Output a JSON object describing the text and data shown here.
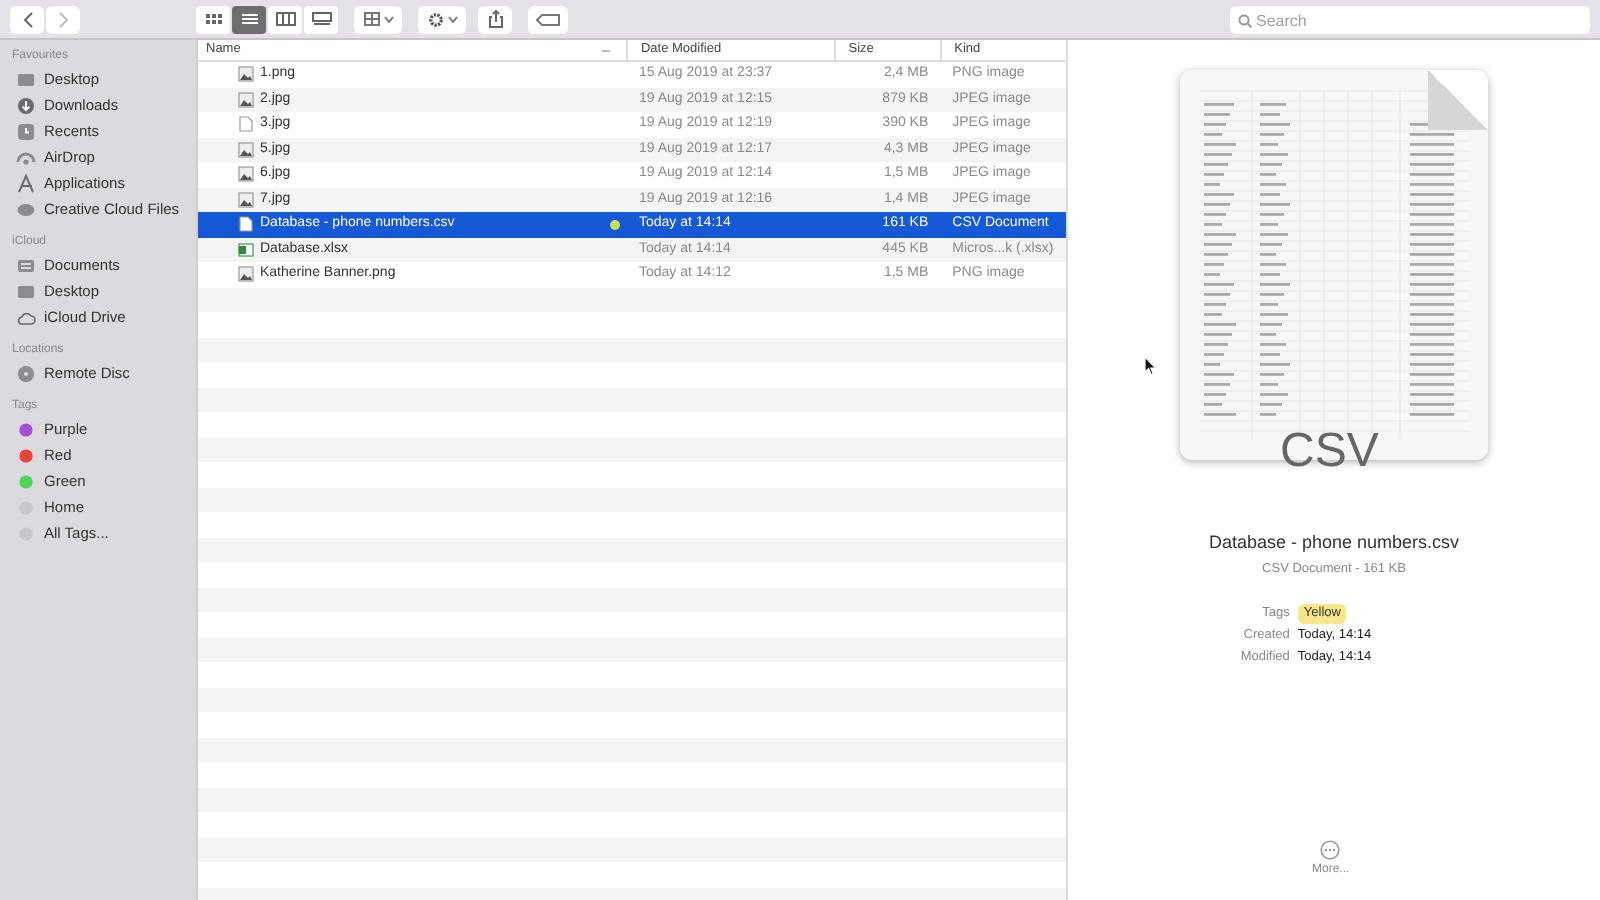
{
  "toolbar": {
    "views": [
      {
        "kind": "icons",
        "selected": false
      },
      {
        "kind": "list",
        "selected": true
      },
      {
        "kind": "columns",
        "selected": false
      },
      {
        "kind": "gallery",
        "selected": false
      }
    ],
    "search": {
      "placeholder": "Search"
    }
  },
  "sidebar": [
    {
      "title": "Favourites",
      "items": [
        {
          "label": "Desktop",
          "kind": "desktop"
        },
        {
          "label": "Downloads",
          "kind": "download"
        },
        {
          "label": "Recents",
          "kind": "clock"
        },
        {
          "label": "AirDrop",
          "kind": "airdrop"
        },
        {
          "label": "Applications",
          "kind": "apps"
        },
        {
          "label": "Creative Cloud Files",
          "kind": "cloudfolder"
        }
      ]
    },
    {
      "title": "iCloud",
      "items": [
        {
          "label": "Documents",
          "kind": "doc"
        },
        {
          "label": "Desktop",
          "kind": "desktop"
        },
        {
          "label": "iCloud Drive",
          "kind": "cloud"
        }
      ]
    },
    {
      "title": "Locations",
      "items": [
        {
          "label": "Remote Disc",
          "kind": "disc"
        }
      ]
    },
    {
      "title": "Tags",
      "items": [
        {
          "label": "Purple",
          "kind": "tag",
          "color": "#a64fd6"
        },
        {
          "label": "Red",
          "kind": "tag",
          "color": "#e8413b"
        },
        {
          "label": "Green",
          "kind": "tag",
          "color": "#4cd45a"
        },
        {
          "label": "Home",
          "kind": "tag",
          "color": "#c9c6cd"
        },
        {
          "label": "All Tags...",
          "kind": "alltags"
        }
      ]
    }
  ],
  "table": {
    "columns": [
      "Name",
      "Date Modified",
      "Size",
      "Kind"
    ],
    "rows": [
      {
        "name": "1.png",
        "date": "15 Aug 2019 at 23:37",
        "size": "2,4 MB",
        "type": "PNG image",
        "kind": "image",
        "selected": false
      },
      {
        "name": "2.jpg",
        "date": "19 Aug 2019 at 12:15",
        "size": "879 KB",
        "type": "JPEG image",
        "kind": "image",
        "selected": false
      },
      {
        "name": "3.jpg",
        "date": "19 Aug 2019 at 12:19",
        "size": "390 KB",
        "type": "JPEG image",
        "kind": "blank",
        "selected": false
      },
      {
        "name": "5.jpg",
        "date": "19 Aug 2019 at 12:17",
        "size": "4,3 MB",
        "type": "JPEG image",
        "kind": "image",
        "selected": false
      },
      {
        "name": "6.jpg",
        "date": "19 Aug 2019 at 12:14",
        "size": "1,5 MB",
        "type": "JPEG image",
        "kind": "image",
        "selected": false
      },
      {
        "name": "7.jpg",
        "date": "19 Aug 2019 at 12:16",
        "size": "1,4 MB",
        "type": "JPEG image",
        "kind": "image",
        "selected": false
      },
      {
        "name": "Database - phone numbers.csv",
        "date": "Today at 14:14",
        "size": "161 KB",
        "type": "CSV Document",
        "kind": "blank",
        "selected": true,
        "color": "#c8e05a"
      },
      {
        "name": "Database.xlsx",
        "date": "Today at 14:14",
        "size": "445 KB",
        "type": "Micros...k (.xlsx)",
        "kind": "sheet",
        "selected": false
      },
      {
        "name": "Katherine Banner.png",
        "date": "Today at 14:12",
        "size": "1,5 MB",
        "type": "PNG image",
        "kind": "image",
        "selected": false
      }
    ]
  },
  "preview": {
    "thumbnail_label": "CSV",
    "file_name": "Database - phone numbers.csv",
    "subtitle": "CSV Document - 161 KB",
    "info": [
      {
        "label": "Tags",
        "value": "Yellow",
        "kind": "tag"
      },
      {
        "label": "Created",
        "value": "Today, 14:14",
        "kind": "text"
      },
      {
        "label": "Modified",
        "value": "Today, 14:14",
        "kind": "text"
      }
    ],
    "more": "More..."
  }
}
